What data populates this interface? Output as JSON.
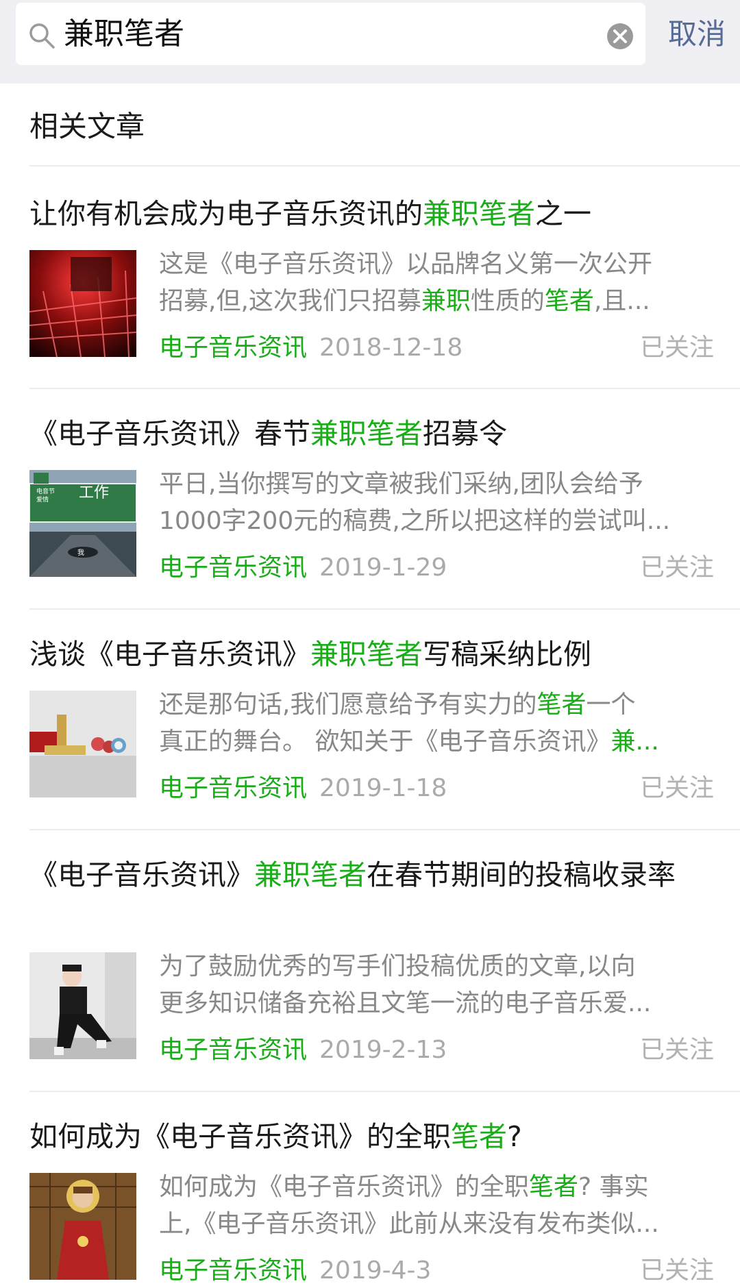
{
  "search": {
    "query": "兼职笔者",
    "cancel_label": "取消"
  },
  "section": {
    "title": "相关文章"
  },
  "articles": [
    {
      "title_parts": [
        {
          "text": "让你有机会成为电子音乐资讯的",
          "hl": false
        },
        {
          "text": "兼职笔者",
          "hl": true
        },
        {
          "text": "之一",
          "hl": false
        }
      ],
      "summary_lines": [
        [
          {
            "text": "这是《电子音乐资讯》以品牌名义第一次公开",
            "hl": false
          }
        ],
        [
          {
            "text": "招募,但,这次我们只招募",
            "hl": false
          },
          {
            "text": "兼职",
            "hl": true
          },
          {
            "text": "性质的",
            "hl": false
          },
          {
            "text": "笔者",
            "hl": true
          },
          {
            "text": ",且...",
            "hl": false
          }
        ]
      ],
      "source": "电子音乐资讯",
      "date": "2018-12-18",
      "follow_label": "已关注",
      "thumb": "red-neon-abstract"
    },
    {
      "title_parts": [
        {
          "text": "《电子音乐资讯》春节",
          "hl": false
        },
        {
          "text": "兼职笔者",
          "hl": true
        },
        {
          "text": "招募令",
          "hl": false
        }
      ],
      "summary_lines": [
        [
          {
            "text": "平日,当你撰写的文章被我们采纳,团队会给予",
            "hl": false
          }
        ],
        [
          {
            "text": "1000字200元的稿费,之所以把这样的尝试叫...",
            "hl": false
          }
        ]
      ],
      "source": "电子音乐资讯",
      "date": "2019-1-29",
      "follow_label": "已关注",
      "thumb": "highway-sign",
      "thumb_text": [
        "工作",
        "电音节",
        "爱情",
        "我"
      ]
    },
    {
      "title_parts": [
        {
          "text": "浅谈《电子音乐资讯》",
          "hl": false
        },
        {
          "text": "兼职笔者",
          "hl": true
        },
        {
          "text": "写稿采纳比例",
          "hl": false
        }
      ],
      "summary_lines": [
        [
          {
            "text": "还是那句话,我们愿意给予有实力的",
            "hl": false
          },
          {
            "text": "笔者",
            "hl": true
          },
          {
            "text": "一个",
            "hl": false
          }
        ],
        [
          {
            "text": "真正的舞台。 欲知关于《电子音乐资讯》",
            "hl": false
          },
          {
            "text": "兼...",
            "hl": true
          }
        ]
      ],
      "source": "电子音乐资讯",
      "date": "2019-1-18",
      "follow_label": "已关注",
      "thumb": "still-life-objects"
    },
    {
      "title_parts": [
        {
          "text": "《电子音乐资讯》",
          "hl": false
        },
        {
          "text": "兼职笔者",
          "hl": true
        },
        {
          "text": "在春节期间的投稿收录率",
          "hl": false
        }
      ],
      "summary_lines": [
        [
          {
            "text": "为了鼓励优秀的写手们投稿优质的文章,以向",
            "hl": false
          }
        ],
        [
          {
            "text": "更多知识储备充裕且文笔一流的电子音乐爱...",
            "hl": false
          }
        ]
      ],
      "source": "电子音乐资讯",
      "date": "2019-2-13",
      "follow_label": "已关注",
      "thumb": "person-sitting"
    },
    {
      "title_parts": [
        {
          "text": "如何成为《电子音乐资讯》的全职",
          "hl": false
        },
        {
          "text": "笔者",
          "hl": true
        },
        {
          "text": "?",
          "hl": false
        }
      ],
      "summary_lines": [
        [
          {
            "text": "如何成为《电子音乐资讯》的全职",
            "hl": false
          },
          {
            "text": "笔者",
            "hl": true
          },
          {
            "text": "? 事实",
            "hl": false
          }
        ],
        [
          {
            "text": "上,《电子音乐资讯》此前从来没有发布类似...",
            "hl": false
          }
        ]
      ],
      "source": "电子音乐资讯",
      "date": "2019-4-3",
      "follow_label": "已关注",
      "thumb": "religious-painting"
    }
  ],
  "colors": {
    "highlight": "#1aad19",
    "link": "#576b95",
    "muted": "#888888",
    "background": "#efeff4"
  }
}
